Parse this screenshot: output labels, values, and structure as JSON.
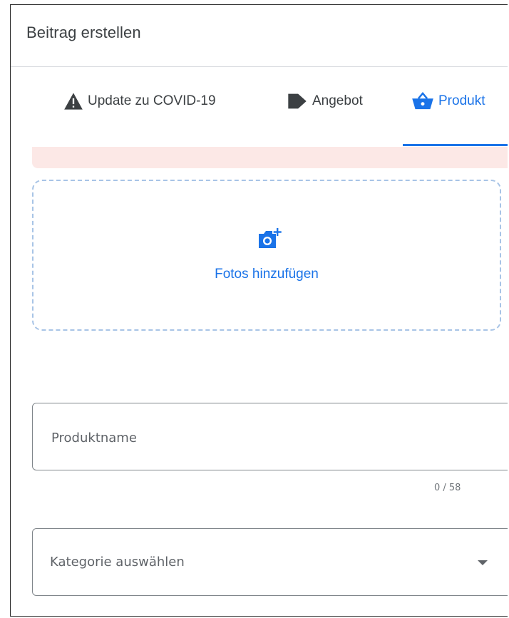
{
  "header": {
    "title": "Beitrag erstellen"
  },
  "tabs": [
    {
      "label": "Update zu COVID-19",
      "icon": "warning-icon",
      "active": false
    },
    {
      "label": "Angebot",
      "icon": "tag-icon",
      "active": false
    },
    {
      "label": "Produkt",
      "icon": "shopping-basket-icon",
      "active": true
    }
  ],
  "photos": {
    "label": "Fotos hinzufügen",
    "icon": "add-photo-camera-icon"
  },
  "product_name": {
    "value": "",
    "placeholder": "Produktname",
    "counter": "0 / 58"
  },
  "category": {
    "selected": "Kategorie auswählen",
    "icon": "dropdown-caret-icon"
  },
  "colors": {
    "accent": "#1a73e8",
    "text": "#3c4043",
    "alert_background": "#fce8e6",
    "dashed_border": "#a8c4e6",
    "field_border": "#80868b"
  }
}
